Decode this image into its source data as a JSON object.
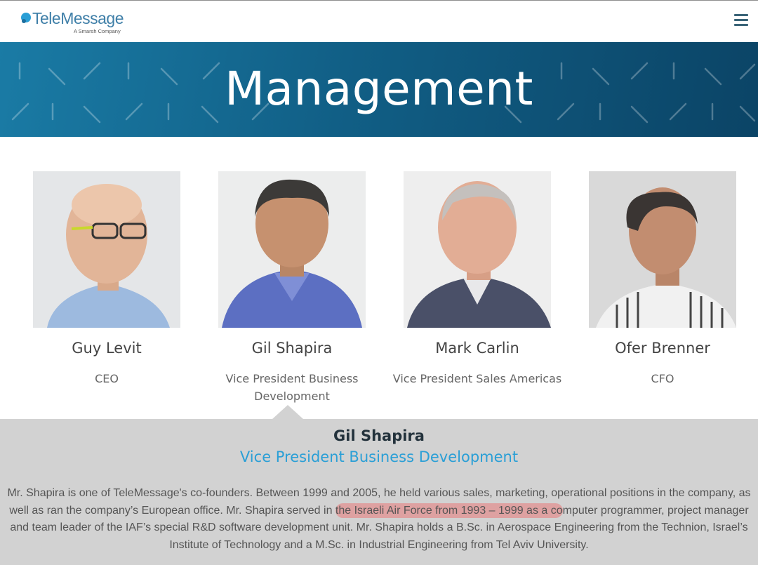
{
  "header": {
    "logo_text": "TeleMessage",
    "logo_tagline": "A Smarsh Company",
    "menu_icon": "hamburger-menu-icon"
  },
  "hero": {
    "title": "Management"
  },
  "team": [
    {
      "name": "Guy Levit",
      "role": "CEO"
    },
    {
      "name": "Gil Shapira",
      "role": "Vice President Business Development"
    },
    {
      "name": "Mark Carlin",
      "role": "Vice President Sales Americas"
    },
    {
      "name": "Ofer Brenner",
      "role": "CFO"
    }
  ],
  "detail": {
    "name": "Gil Shapira",
    "role": "Vice President Business Development",
    "bio_before": "Mr. Shapira is one of TeleMessage's co-founders. Between 1999 and 2005, he held various sales, marketing, operational positions in the company, as well as ran the company’s European office. Mr. Shapira served in ",
    "bio_highlight": "the Israeli Air Force from 1993 – 1999 as a co",
    "bio_after": "mputer programmer, project manager and team leader of the IAF’s special R&D software development unit. Mr. Shapira holds a B.Sc. in Aerospace Engineering from the Technion, Israel’s Institute of Technology and a M.Sc. in Industrial Engineering from Tel Aviv University."
  },
  "colors": {
    "hero_start": "#1a7ba5",
    "hero_end": "#0b4466",
    "accent_blue": "#2a9fd6",
    "detail_bg": "#d2d2d2",
    "highlight": "#e87878"
  }
}
